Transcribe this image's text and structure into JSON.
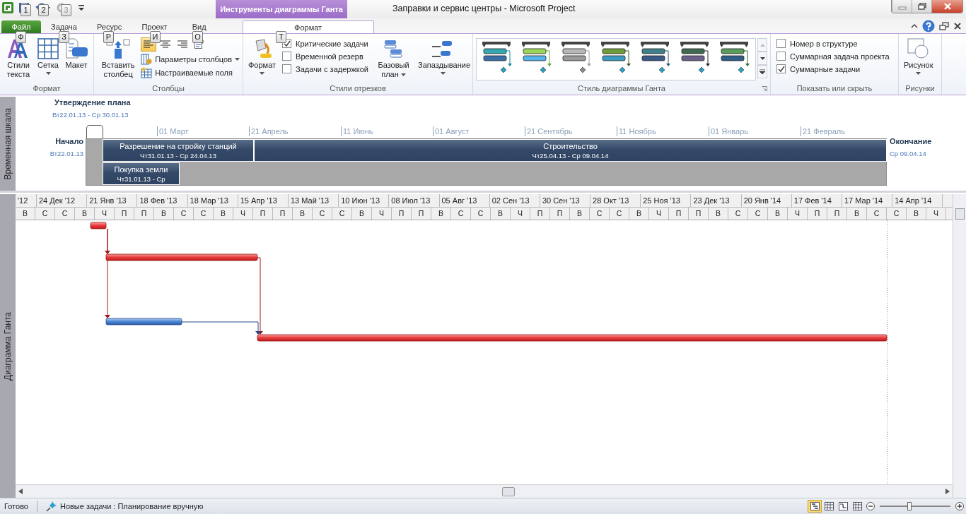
{
  "window": {
    "title": "Заправки и сервис центры  -  Microsoft Project",
    "context_group": "Инструменты диаграммы Ганта"
  },
  "keytips": [
    {
      "label": "1",
      "kind": "qat"
    },
    {
      "label": "2",
      "kind": "qat"
    },
    {
      "label": "3",
      "kind": "qat-off"
    },
    {
      "label": "Ф",
      "kind": "tab"
    },
    {
      "label": "З",
      "kind": "tab"
    },
    {
      "label": "Р",
      "kind": "tab"
    },
    {
      "label": "И",
      "kind": "tab"
    },
    {
      "label": "О",
      "kind": "tab"
    },
    {
      "label": "Т",
      "kind": "ctx"
    }
  ],
  "tabs": [
    {
      "label": "Файл",
      "kind": "file",
      "selected": false
    },
    {
      "label": "Задача",
      "kind": "tab",
      "selected": false
    },
    {
      "label": "Ресурс",
      "kind": "tab",
      "selected": false
    },
    {
      "label": "Проект",
      "kind": "tab",
      "selected": false
    },
    {
      "label": "Вид",
      "kind": "tab",
      "selected": false
    },
    {
      "label": "Формат",
      "kind": "ctx",
      "selected": true
    }
  ],
  "ribbon": {
    "format_group": {
      "label": "Формат",
      "buttons": [
        {
          "label": "Стили текста",
          "kind": "text-styles",
          "dropdown": false
        },
        {
          "label": "Сетка",
          "kind": "grid",
          "dropdown": true
        },
        {
          "label": "Макет",
          "kind": "layout",
          "dropdown": false
        }
      ]
    },
    "columns_group": {
      "label": "Столбцы",
      "insert": "Вставить столбец",
      "align_buttons": [
        {
          "kind": "left",
          "selected": true
        },
        {
          "kind": "center",
          "selected": false
        },
        {
          "kind": "right",
          "selected": false
        },
        {
          "kind": "wrap",
          "selected": false
        }
      ],
      "settings": "Параметры столбцов",
      "custom_fields": "Настраиваемые поля"
    },
    "bar_styles_group": {
      "label": "Стили отрезков",
      "format": "Формат",
      "checks": [
        {
          "label": "Критические задачи",
          "checked": true
        },
        {
          "label": "Временной резерв",
          "checked": false
        },
        {
          "label": "Задачи с задержкой",
          "checked": false
        }
      ],
      "baseline": "Базовый план",
      "slippage": "Запаздывание"
    },
    "gantt_style_group": {
      "label": "Стиль диаграммы Ганта"
    },
    "show_hide_group": {
      "label": "Показать или скрыть",
      "checks": [
        {
          "label": "Номер в структуре",
          "checked": false
        },
        {
          "label": "Суммарная задача проекта",
          "checked": false
        },
        {
          "label": "Суммарные задачи",
          "checked": true
        }
      ]
    },
    "drawings_group": {
      "label": "Рисунки",
      "button": "Рисунок"
    }
  },
  "timeline": {
    "side_label": "Временная шкала",
    "milestone": {
      "title": "Утверждение плана",
      "dates": "Вт22.01.13 - Ср 30.01.13"
    },
    "start": {
      "label": "Начало",
      "date": "Вт22.01.13"
    },
    "finish": {
      "label": "Окончание",
      "date": "Ср 09.04.14"
    },
    "ticks": [
      "01 Март",
      "21 Апрель",
      "11 Июнь",
      "01 Август",
      "21 Сентябрь",
      "11 Ноябрь",
      "01 Январь",
      "21 Февраль"
    ],
    "tasks": [
      {
        "name": "Разрешение на стройку станций",
        "dates": "Чт31.01.13 - Ср 24.04.13"
      },
      {
        "name": "Строительство",
        "dates": "Чт25.04.13 - Ср 09.04.14"
      },
      {
        "name": "Покупка земли",
        "dates": "Чт31.01.13 - Ср"
      }
    ]
  },
  "gantt": {
    "side_label": "Диаграмма Ганта",
    "major_scale": [
      "'12",
      "24 Дек '12",
      "21 Янв '13",
      "18 Фев '13",
      "18 Мар '13",
      "15 Апр '13",
      "13 Май '13",
      "10 Июн '13",
      "08 Июл '13",
      "05 Авг '13",
      "02 Сен '13",
      "30 Сен '13",
      "28 Окт '13",
      "25 Ноя '13",
      "23 Дек '13",
      "20 Янв '14",
      "17 Фев '14",
      "17 Мар '14",
      "14 Апр '14"
    ],
    "minor_scale": [
      "В",
      "С",
      "С",
      "В",
      "Ч",
      "П",
      "П",
      "В",
      "С",
      "С",
      "В",
      "Ч",
      "П",
      "П",
      "В",
      "С",
      "С",
      "В",
      "Ч",
      "П",
      "П",
      "В",
      "С",
      "С",
      "В",
      "Ч",
      "П",
      "П",
      "В",
      "С",
      "С",
      "В",
      "Ч",
      "П",
      "П",
      "В",
      "С",
      "С",
      "В",
      "Ч",
      "П",
      "П",
      "В",
      "С",
      "С",
      "В",
      "Ч"
    ],
    "bars": [
      {
        "critical": true
      },
      {
        "critical": true
      },
      {
        "critical": false
      },
      {
        "critical": true
      }
    ],
    "links": [
      {
        "critical": true
      },
      {
        "critical": true
      },
      {
        "critical": true
      },
      {
        "critical": false
      }
    ]
  },
  "status_bar": {
    "ready": "Готово",
    "new_tasks": "Новые задачи : Планирование вручную",
    "views": [
      {
        "kind": "gantt",
        "selected": true
      },
      {
        "kind": "usage",
        "selected": false
      },
      {
        "kind": "network",
        "selected": false
      },
      {
        "kind": "sheet",
        "selected": false
      }
    ],
    "zoom": {
      "level": 0.42
    }
  }
}
